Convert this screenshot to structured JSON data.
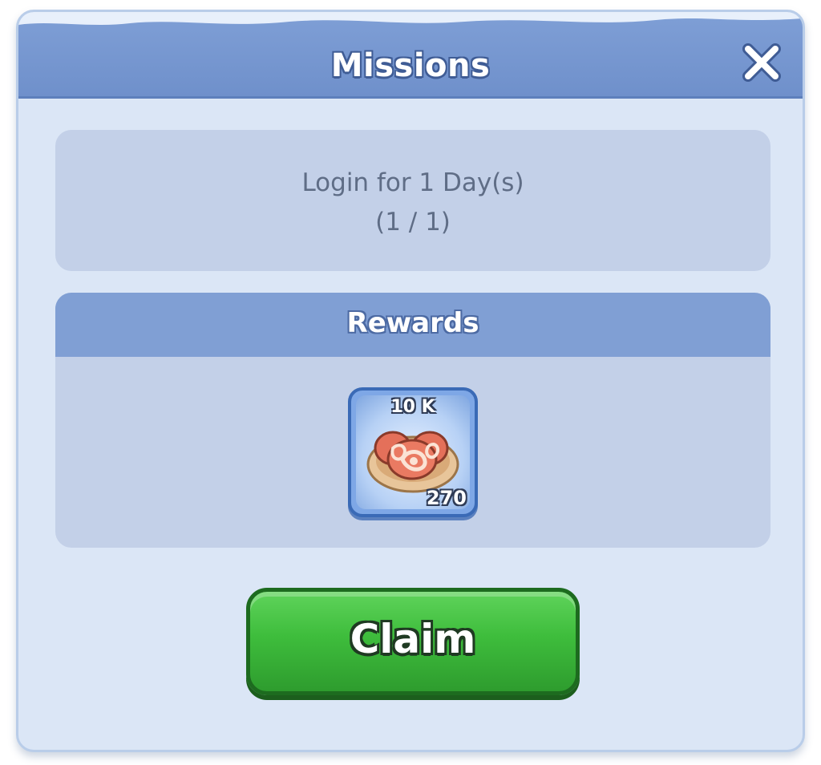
{
  "dialog": {
    "title": "Missions",
    "close_icon": "close-icon"
  },
  "mission": {
    "description": "Login for 1 Day(s)",
    "progress": "(1 / 1)"
  },
  "rewards": {
    "header": "Rewards",
    "items": [
      {
        "icon": "meat-icon",
        "top_label": "10 K",
        "count": "270"
      }
    ]
  },
  "actions": {
    "claim_label": "Claim"
  },
  "colors": {
    "panel_bg": "#dbe6f6",
    "title_bar": "#7f9fd6",
    "section_bg": "#c3d0e8",
    "rewards_header": "#809fd4",
    "claim_green": "#3ebd3c"
  }
}
